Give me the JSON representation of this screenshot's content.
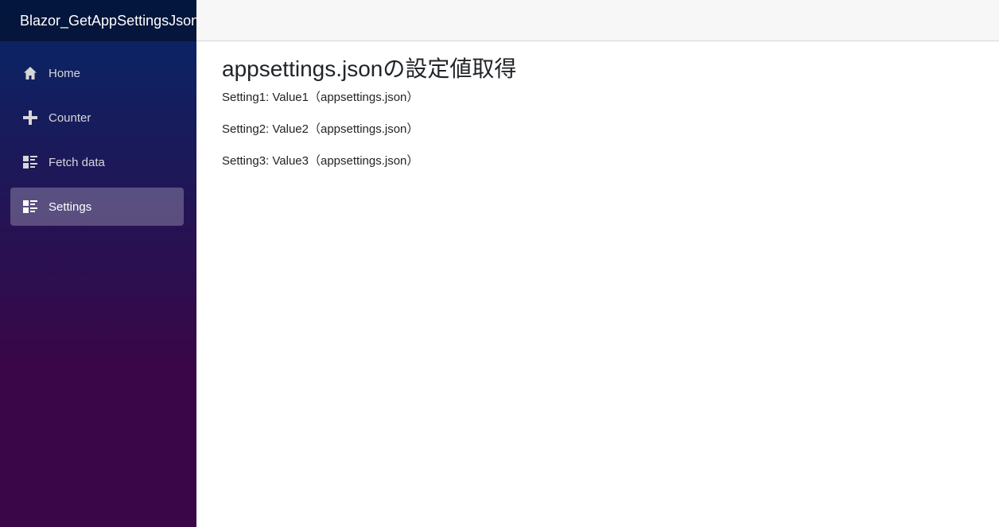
{
  "sidebar": {
    "brand": "Blazor_GetAppSettingsJson",
    "items": [
      {
        "label": "Home",
        "icon": "home-icon",
        "active": false
      },
      {
        "label": "Counter",
        "icon": "plus-icon",
        "active": false
      },
      {
        "label": "Fetch data",
        "icon": "list-rich-icon",
        "active": false
      },
      {
        "label": "Settings",
        "icon": "list-rich-icon",
        "active": true
      }
    ]
  },
  "main": {
    "title": "appsettings.jsonの設定値取得",
    "settings": [
      {
        "name": "Setting1",
        "value": "Value1（appsettings.json）"
      },
      {
        "name": "Setting2",
        "value": "Value2（appsettings.json）"
      },
      {
        "name": "Setting3",
        "value": "Value3（appsettings.json）"
      }
    ]
  },
  "colors": {
    "sidebar_top": "#052767",
    "sidebar_bottom": "#3a0647",
    "top_row_bg": "#f7f7f7",
    "text": "#212529"
  }
}
